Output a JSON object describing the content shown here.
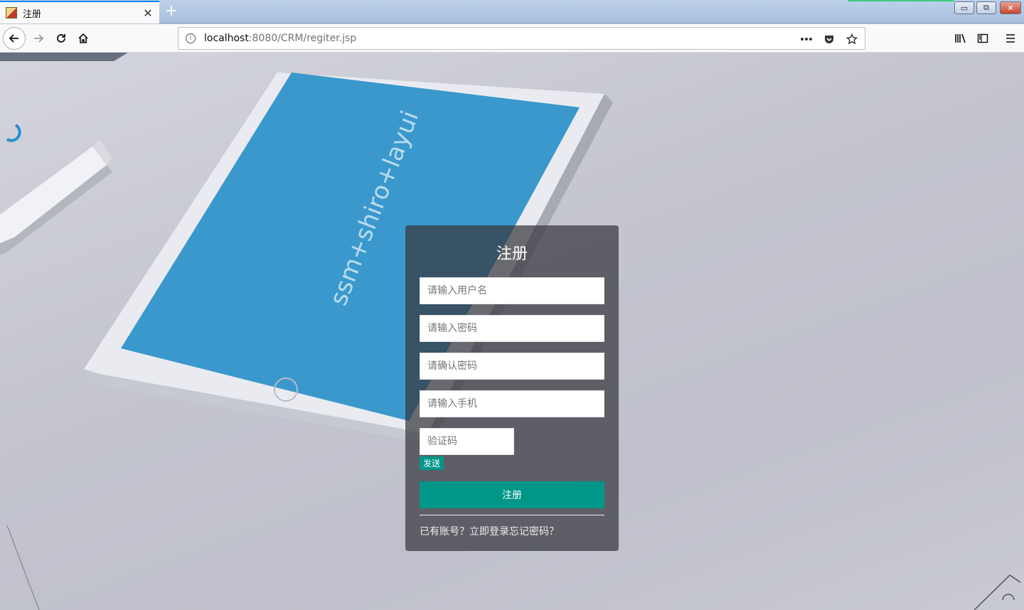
{
  "browser": {
    "tab_title": "注册",
    "tab_close": "✕",
    "new_tab": "+",
    "url_host": "localhost",
    "url_path": ":8080/CRM/regiter.jsp",
    "window_controls": {
      "minimize": "▭",
      "maximize": "⧉",
      "close": "✕"
    },
    "icons": [
      "back-icon",
      "forward-icon",
      "reload-icon",
      "home-icon",
      "info-icon",
      "more-icon",
      "pocket-icon",
      "star-icon",
      "library-icon",
      "sidebar-icon",
      "menu-icon"
    ]
  },
  "background": {
    "tablet_text": "ssm+shiro+layui",
    "tablet_screen_color": "#3a98cc"
  },
  "register": {
    "title": "注册",
    "username_placeholder": "请输入用户名",
    "password_placeholder": "请输入密码",
    "confirm_password_placeholder": "请确认密码",
    "phone_placeholder": "请输入手机",
    "captcha_placeholder": "验证码",
    "send_label": "发送",
    "submit_label": "注册",
    "have_account_text": "已有账号？",
    "login_link": "立即登录",
    "forgot_link": "忘记密码？",
    "accent_color": "#009688"
  }
}
